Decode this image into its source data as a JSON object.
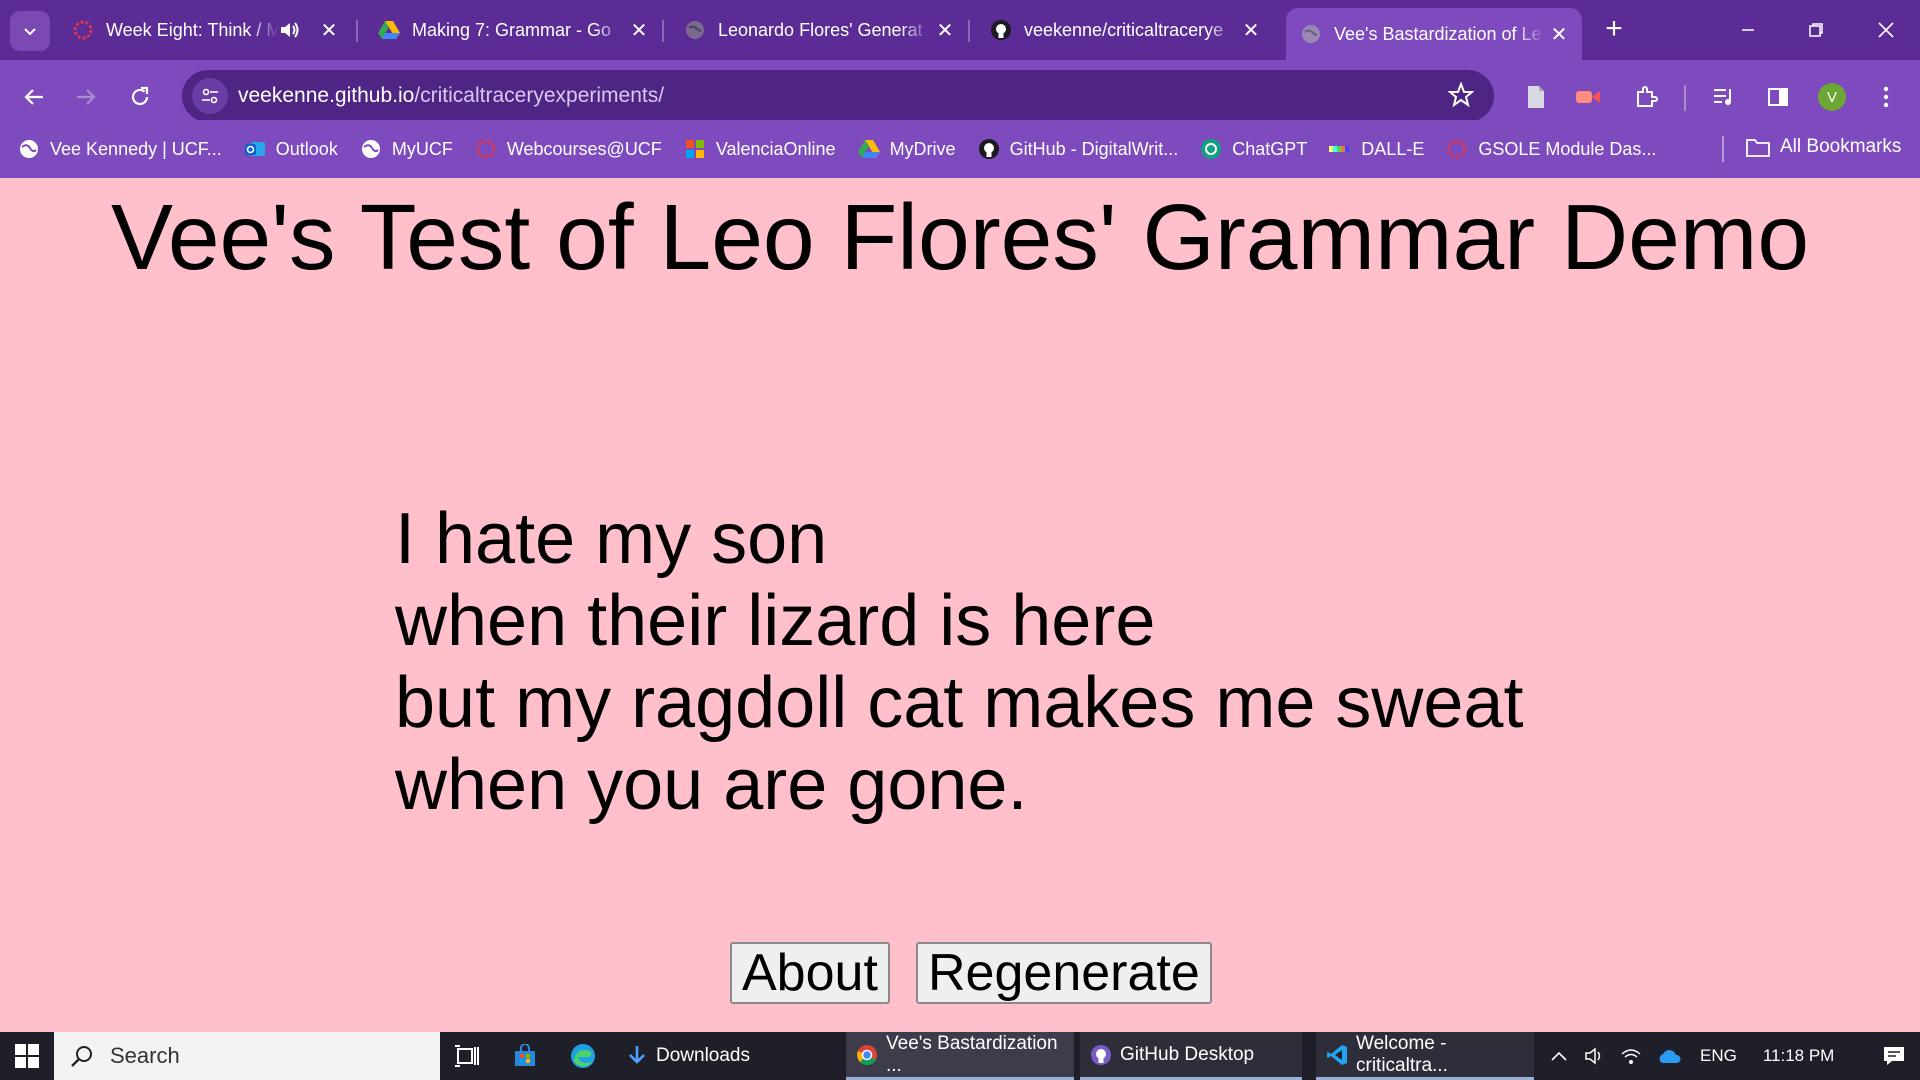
{
  "browser": {
    "tabs": [
      {
        "title": "Week Eight: Think / M",
        "favicon": "webcourses-icon",
        "audio": true
      },
      {
        "title": "Making 7: Grammar - Go",
        "favicon": "google-drive-icon"
      },
      {
        "title": "Leonardo Flores' Generat",
        "favicon": "globe-icon"
      },
      {
        "title": "veekenne/criticaltracerye",
        "favicon": "github-icon"
      },
      {
        "title": "Vee's Bastardization of Le",
        "favicon": "globe-icon",
        "active": true
      }
    ],
    "new_tab_label": "+",
    "address": {
      "host": "veekenne.github.io",
      "path": "/criticaltraceryexperiments/"
    },
    "profile_initial": "V",
    "bookmarks": [
      {
        "label": "Vee Kennedy | UCF...",
        "icon": "globe-icon"
      },
      {
        "label": "Outlook",
        "icon": "outlook-icon"
      },
      {
        "label": "MyUCF",
        "icon": "globe-icon"
      },
      {
        "label": "Webcourses@UCF",
        "icon": "webcourses-icon"
      },
      {
        "label": "ValenciaOnline",
        "icon": "valencia-icon"
      },
      {
        "label": "MyDrive",
        "icon": "google-drive-icon"
      },
      {
        "label": "GitHub - DigitalWrit...",
        "icon": "github-icon"
      },
      {
        "label": "ChatGPT",
        "icon": "chatgpt-icon"
      },
      {
        "label": "DALL-E",
        "icon": "dalle-icon"
      },
      {
        "label": "GSOLE Module Das...",
        "icon": "webcourses-icon"
      }
    ],
    "all_bookmarks_label": "All Bookmarks"
  },
  "page": {
    "title": "Vee's Test of Leo Flores' Grammar Demo",
    "poem_lines": [
      "I hate my son",
      "when their lizard is here",
      "but my ragdoll cat makes me sweat",
      "when you are gone."
    ],
    "about_label": "About",
    "regenerate_label": "Regenerate"
  },
  "taskbar": {
    "search_placeholder": "Search",
    "apps": [
      {
        "label": "Downloads",
        "icon": "download-icon"
      },
      {
        "label": "Vee's Bastardization ...",
        "icon": "chrome-icon"
      },
      {
        "label": "GitHub Desktop",
        "icon": "github-icon"
      },
      {
        "label": "Welcome - criticaltra...",
        "icon": "vscode-icon"
      }
    ],
    "language": "ENG",
    "time": "11:18 PM"
  },
  "colors": {
    "page_background": "#ffbfcb",
    "chrome_purple": "#7e4bbe",
    "tabstrip_purple": "#5b2c95"
  }
}
